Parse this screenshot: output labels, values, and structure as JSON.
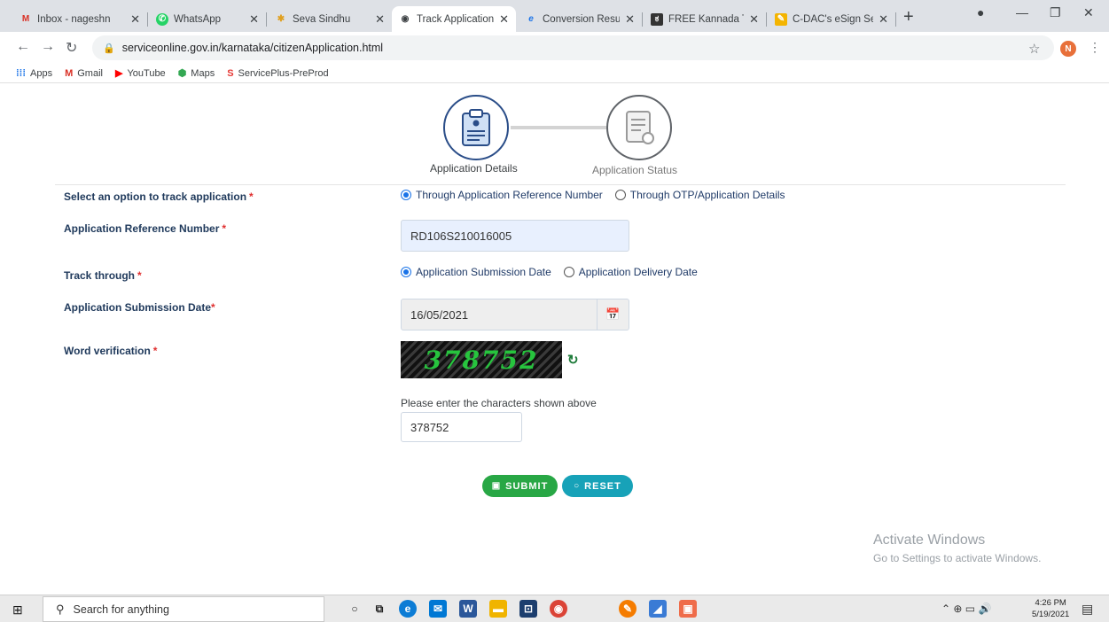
{
  "tabs": [
    {
      "title": "Inbox - nageshn",
      "icon": "gmail-icon",
      "active": false
    },
    {
      "title": "WhatsApp",
      "icon": "whatsapp-icon",
      "active": false
    },
    {
      "title": "Seva Sindhu",
      "icon": "seva-sindhu-icon",
      "active": false
    },
    {
      "title": "Track Application",
      "icon": "globe-icon",
      "active": true
    },
    {
      "title": "Conversion Resul",
      "icon": "ie-icon",
      "active": false
    },
    {
      "title": "FREE Kannada Ty",
      "icon": "kannada-icon",
      "active": false
    },
    {
      "title": "C-DAC's eSign Se",
      "icon": "edit-icon",
      "active": false
    }
  ],
  "address": {
    "url": "serviceonline.gov.in/karnataka/citizenApplication.html"
  },
  "profile_initial": "N",
  "bookmarks": [
    {
      "label": "Apps"
    },
    {
      "label": "Gmail"
    },
    {
      "label": "YouTube"
    },
    {
      "label": "Maps"
    },
    {
      "label": "ServicePlus-PreProd"
    }
  ],
  "stepper": {
    "step1": "Application Details",
    "step2": "Application Status"
  },
  "form": {
    "track_option_label": "Select an option to track application",
    "track_option_1": "Through Application Reference Number",
    "track_option_2": "Through OTP/Application Details",
    "ref_label": "Application Reference Number",
    "ref_value": "RD106S210016005",
    "track_through_label": "Track through",
    "track_through_1": "Application Submission Date",
    "track_through_2": "Application Delivery Date",
    "submission_date_label": "Application Submission Date",
    "submission_date_value": "16/05/2021",
    "word_verification_label": "Word verification",
    "captcha_text": "378752",
    "captcha_hint": "Please enter the characters shown above",
    "captcha_input_value": "378752",
    "required_mark": "*"
  },
  "buttons": {
    "submit": "SUBMIT",
    "reset": "RESET"
  },
  "watermark": {
    "line1": "Activate Windows",
    "line2": "Go to Settings to activate Windows."
  },
  "taskbar": {
    "search_placeholder": "Search for anything",
    "time": "4:26 PM",
    "date": "5/19/2021"
  }
}
